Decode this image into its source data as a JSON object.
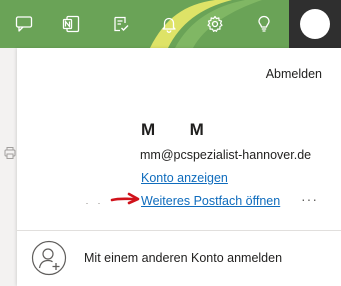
{
  "topbar": {
    "color": "#6aa357",
    "icons": [
      "chat-icon",
      "onenote-icon",
      "todo-icon",
      "bell-icon",
      "gear-icon",
      "lightbulb-icon"
    ]
  },
  "panel": {
    "sign_out_label": "Abmelden",
    "user": {
      "name_initials": [
        "M",
        "M"
      ],
      "email": "mm@pcspezialist-hannover.de"
    },
    "view_account_label": "Konto anzeigen",
    "open_mailbox_label": "Weiteres Postfach öffnen",
    "more_label": "···",
    "other_account_label": "Mit einem anderen Konto anmelden",
    "link_color": "#0f6cbd",
    "annotation_arrow_color": "#d0121b"
  }
}
